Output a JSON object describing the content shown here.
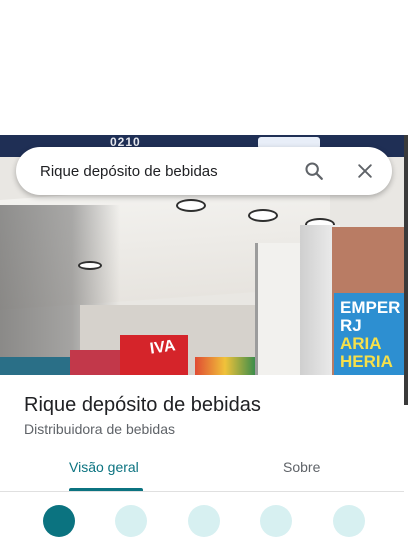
{
  "search": {
    "query": "Rique depósito de bebidas",
    "search_icon": "search-icon",
    "close_icon": "close-icon"
  },
  "place": {
    "name": "Rique depósito de bebidas",
    "category": "Distribuidora de bebidas"
  },
  "tabs": [
    {
      "label": "Visão geral",
      "active": true
    },
    {
      "label": "Sobre",
      "active": false
    }
  ],
  "colors": {
    "accent": "#0b7380",
    "action_circle_primary": "#0b7380",
    "action_circle_light": "#d7f0f1"
  },
  "photo": {
    "storefront_sign": "0210",
    "banner_text_1": "EMPER",
    "banner_text_2": "RJ",
    "banner_text_3": "ARIA",
    "banner_text_4": "HERIA",
    "fridge_text": "IVA"
  }
}
